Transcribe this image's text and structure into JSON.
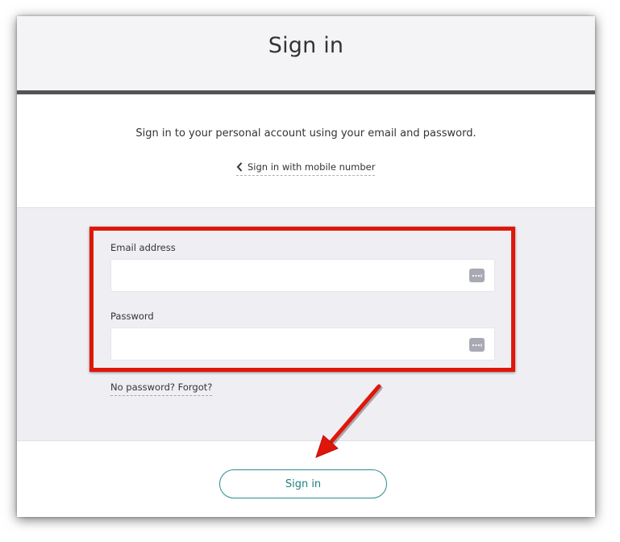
{
  "header": {
    "title": "Sign in"
  },
  "intro": {
    "text": "Sign in to your personal account using your email and password.",
    "mobile_link": "Sign in with mobile number"
  },
  "form": {
    "email": {
      "label": "Email address",
      "value": "",
      "placeholder": ""
    },
    "password": {
      "label": "Password",
      "value": "",
      "placeholder": ""
    },
    "forgot_link": "No password? Forgot?"
  },
  "actions": {
    "signin_label": "Sign in"
  },
  "colors": {
    "accent": "#2a8c8f",
    "highlight": "#e0160b",
    "header_bg": "#f4f4f7",
    "form_bg": "#efeff3",
    "header_rule": "#545454"
  },
  "icons": {
    "back": "chevron-left-icon",
    "password_manager": "password-manager-icon",
    "annotation": "annotation-arrow"
  }
}
